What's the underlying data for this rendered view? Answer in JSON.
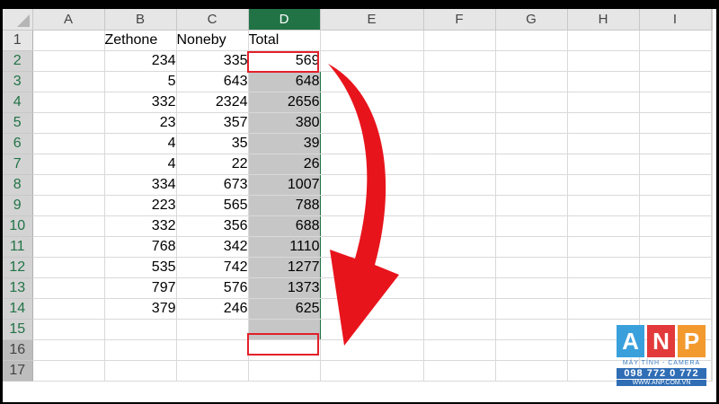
{
  "columns": [
    "A",
    "B",
    "C",
    "D",
    "E",
    "F",
    "G",
    "H",
    "I"
  ],
  "selected_column": "D",
  "headers": {
    "B": "Zethone",
    "C": "Noneby",
    "D": "Total"
  },
  "rows": [
    {
      "n": "2",
      "b": "234",
      "c": "335",
      "d": "569"
    },
    {
      "n": "3",
      "b": "5",
      "c": "643",
      "d": "648"
    },
    {
      "n": "4",
      "b": "332",
      "c": "2324",
      "d": "2656"
    },
    {
      "n": "5",
      "b": "23",
      "c": "357",
      "d": "380"
    },
    {
      "n": "6",
      "b": "4",
      "c": "35",
      "d": "39"
    },
    {
      "n": "7",
      "b": "4",
      "c": "22",
      "d": "26"
    },
    {
      "n": "8",
      "b": "334",
      "c": "673",
      "d": "1007"
    },
    {
      "n": "9",
      "b": "223",
      "c": "565",
      "d": "788"
    },
    {
      "n": "10",
      "b": "332",
      "c": "356",
      "d": "688"
    },
    {
      "n": "11",
      "b": "768",
      "c": "342",
      "d": "1110"
    },
    {
      "n": "12",
      "b": "535",
      "c": "742",
      "d": "1277"
    },
    {
      "n": "13",
      "b": "797",
      "c": "576",
      "d": "1373"
    },
    {
      "n": "14",
      "b": "379",
      "c": "246",
      "d": "625"
    }
  ],
  "row_labels": [
    "1",
    "15",
    "16",
    "17"
  ],
  "logo": {
    "letters": [
      "A",
      "N",
      "P"
    ],
    "letter_colors": [
      "#3aa0dc",
      "#e23a3a",
      "#f29a2e"
    ],
    "tagline": "MÁY TÍNH - CAMERA",
    "phone": "098 772 0 772",
    "website": "WWW.ANP.COM.VN"
  },
  "accent_color": "#e3202a",
  "excel_green": "#217346"
}
